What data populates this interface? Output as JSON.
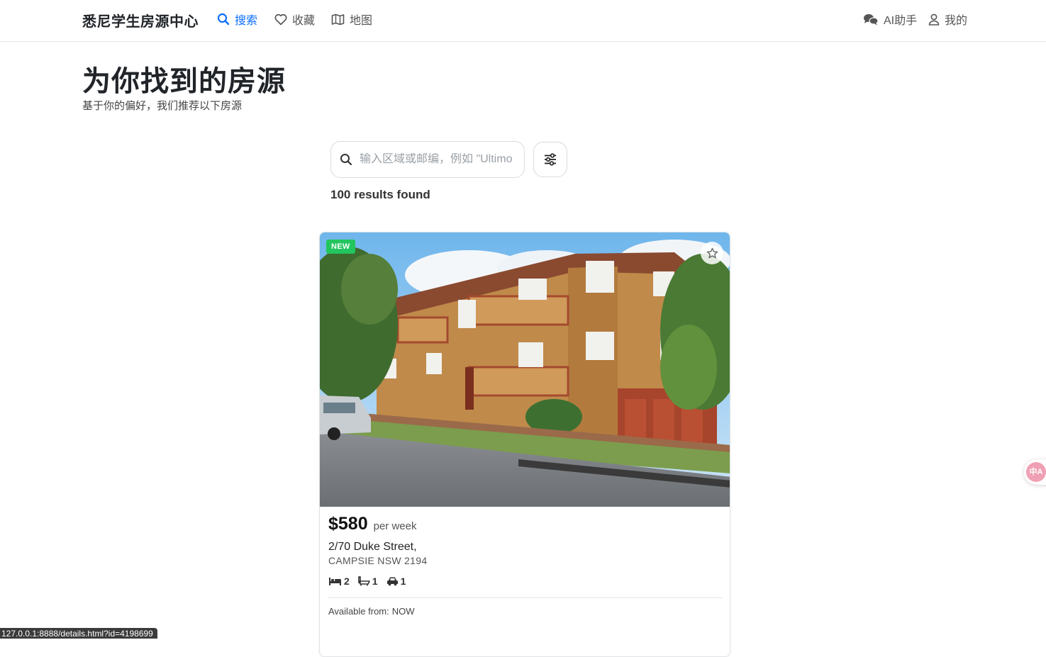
{
  "nav": {
    "brand": "悉尼学生房源中心",
    "search": "搜索",
    "favorites": "收藏",
    "map": "地图",
    "ai": "AI助手",
    "mine": "我的",
    "active_color": "#0d6efd"
  },
  "header": {
    "title": "为你找到的房源",
    "subtitle": "基于你的偏好，我们推荐以下房源"
  },
  "search": {
    "placeholder": "输入区域或邮编，例如 \"Ultimo",
    "value": ""
  },
  "results": {
    "count_text": "100 results found"
  },
  "listing": {
    "badge": "NEW",
    "price": "$580",
    "period": "per week",
    "address_line1": "2/70 Duke Street,",
    "address_line2": "CAMPSIE NSW 2194",
    "bedrooms": "2",
    "bathrooms": "1",
    "parking": "1",
    "available_label": "Available from:",
    "available_value": "NOW",
    "badge_color": "#22c55e"
  },
  "status_bar": {
    "url": "127.0.0.1:8888/details.html?id=4198699"
  },
  "translate": {
    "label": "中A",
    "icon": "translate-icon"
  }
}
